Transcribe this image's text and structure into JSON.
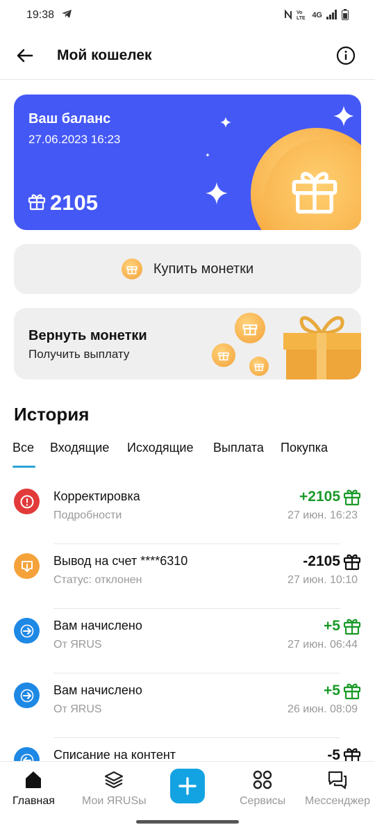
{
  "status_bar": {
    "time": "19:38",
    "network": "4G"
  },
  "header": {
    "title": "Мой кошелек"
  },
  "balance": {
    "label": "Ваш баланс",
    "date": "27.06.2023 16:23",
    "amount": "2105"
  },
  "buy": {
    "label": "Купить монетки"
  },
  "refund": {
    "title": "Вернуть монетки",
    "subtitle": "Получить выплату"
  },
  "history": {
    "title": "История",
    "tabs": [
      "Все",
      "Входящие",
      "Исходящие",
      "Выплата",
      "Покупка"
    ],
    "active_tab": "Все"
  },
  "transactions": [
    {
      "name": "Корректировка",
      "sub": "Подробности",
      "amount": "+2105",
      "time": "27 июн. 16:23",
      "icon": "alert-icon",
      "color": "#e23a3a",
      "positive": true
    },
    {
      "name": "Вывод на счет ****6310",
      "sub": "Статус: отклонен",
      "amount": "-2105",
      "time": "27 июн. 10:10",
      "icon": "withdraw-icon",
      "color": "#f5a23a",
      "positive": false
    },
    {
      "name": "Вам начислено",
      "sub": "От ЯRUS",
      "amount": "+5",
      "time": "27 июн. 06:44",
      "icon": "arrow-right-icon",
      "color": "#1e88e5",
      "positive": true
    },
    {
      "name": "Вам начислено",
      "sub": "От ЯRUS",
      "amount": "+5",
      "time": "26 июн. 08:09",
      "icon": "arrow-right-icon",
      "color": "#1e88e5",
      "positive": true
    },
    {
      "name": "Списание на контент",
      "sub": "",
      "amount": "-5",
      "time": "",
      "icon": "arrow-left-icon",
      "color": "#1e88e5",
      "positive": false
    }
  ],
  "nav": {
    "home": "Главная",
    "my": "Мои ЯRUSы",
    "services": "Сервисы",
    "messenger": "Мессенджер",
    "active": "home"
  },
  "colors": {
    "brand": "#4458f6",
    "positive": "#1a9a2a",
    "accent": "#14a3e2"
  }
}
